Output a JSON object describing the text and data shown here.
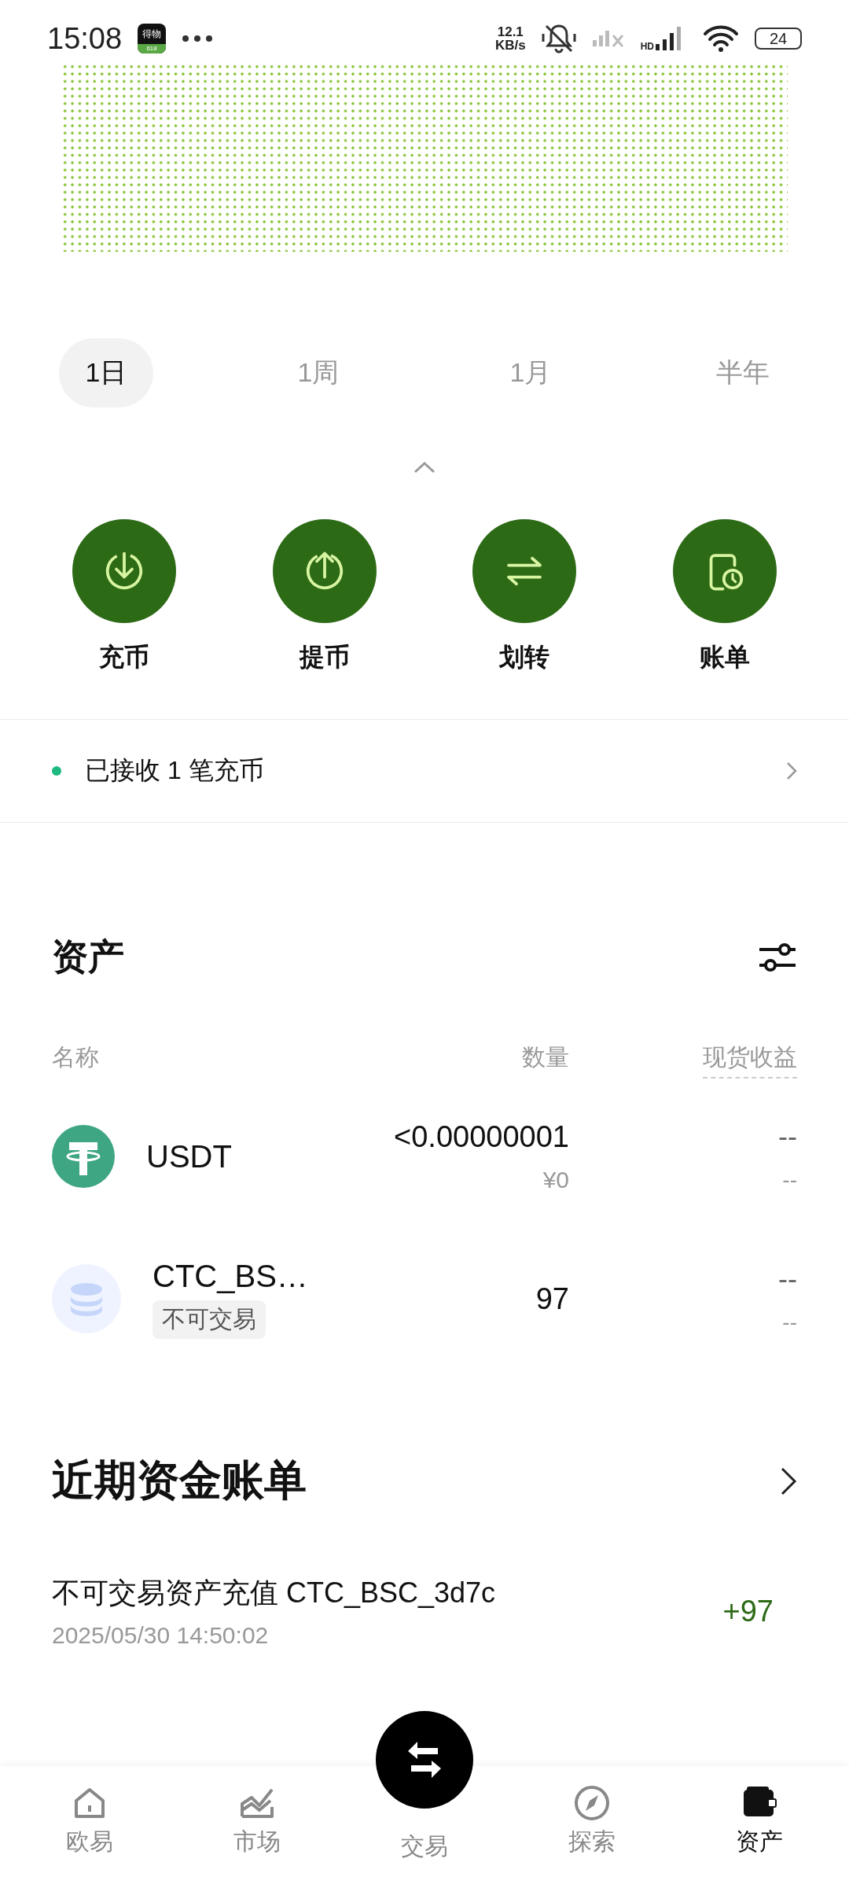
{
  "status_bar": {
    "time": "15:08",
    "app_icon": {
      "name": "得物",
      "badge": "618"
    },
    "net_speed": {
      "value": "12.1",
      "unit": "KB/s"
    },
    "network_label": "HD",
    "battery": "24"
  },
  "periods": [
    {
      "label": "1日",
      "selected": true
    },
    {
      "label": "1周",
      "selected": false
    },
    {
      "label": "1月",
      "selected": false
    },
    {
      "label": "半年",
      "selected": false
    }
  ],
  "actions": [
    {
      "label": "充币",
      "kind": "deposit"
    },
    {
      "label": "提币",
      "kind": "withdraw"
    },
    {
      "label": "划转",
      "kind": "transfer"
    },
    {
      "label": "账单",
      "kind": "bill"
    }
  ],
  "notice": {
    "text": "已接收 1 笔充币"
  },
  "assets": {
    "title": "资产",
    "columns": [
      "名称",
      "数量",
      "现货收益"
    ],
    "rows": [
      {
        "kind": "usdt",
        "name": "USDT",
        "amount": "<0.00000001",
        "value": "¥0",
        "pnl": "--",
        "pnl_sub": "--"
      },
      {
        "kind": "generic",
        "name": "CTC_BS…",
        "tag": "不可交易",
        "amount": "97",
        "pnl": "--",
        "pnl_sub": "--"
      }
    ]
  },
  "recent_bills": {
    "title": "近期资金账单",
    "items": [
      {
        "title": "不可交易资产充值 CTC_BSC_3d7c",
        "time": "2025/05/30 14:50:02",
        "amount": "+97"
      }
    ]
  },
  "bottom_nav": [
    {
      "label": "欧易",
      "kind": "home",
      "selected": false
    },
    {
      "label": "市场",
      "kind": "market",
      "selected": false
    },
    {
      "label": "交易",
      "kind": "trade",
      "selected": false
    },
    {
      "label": "探索",
      "kind": "explore",
      "selected": false
    },
    {
      "label": "资产",
      "kind": "wallet",
      "selected": true
    }
  ]
}
